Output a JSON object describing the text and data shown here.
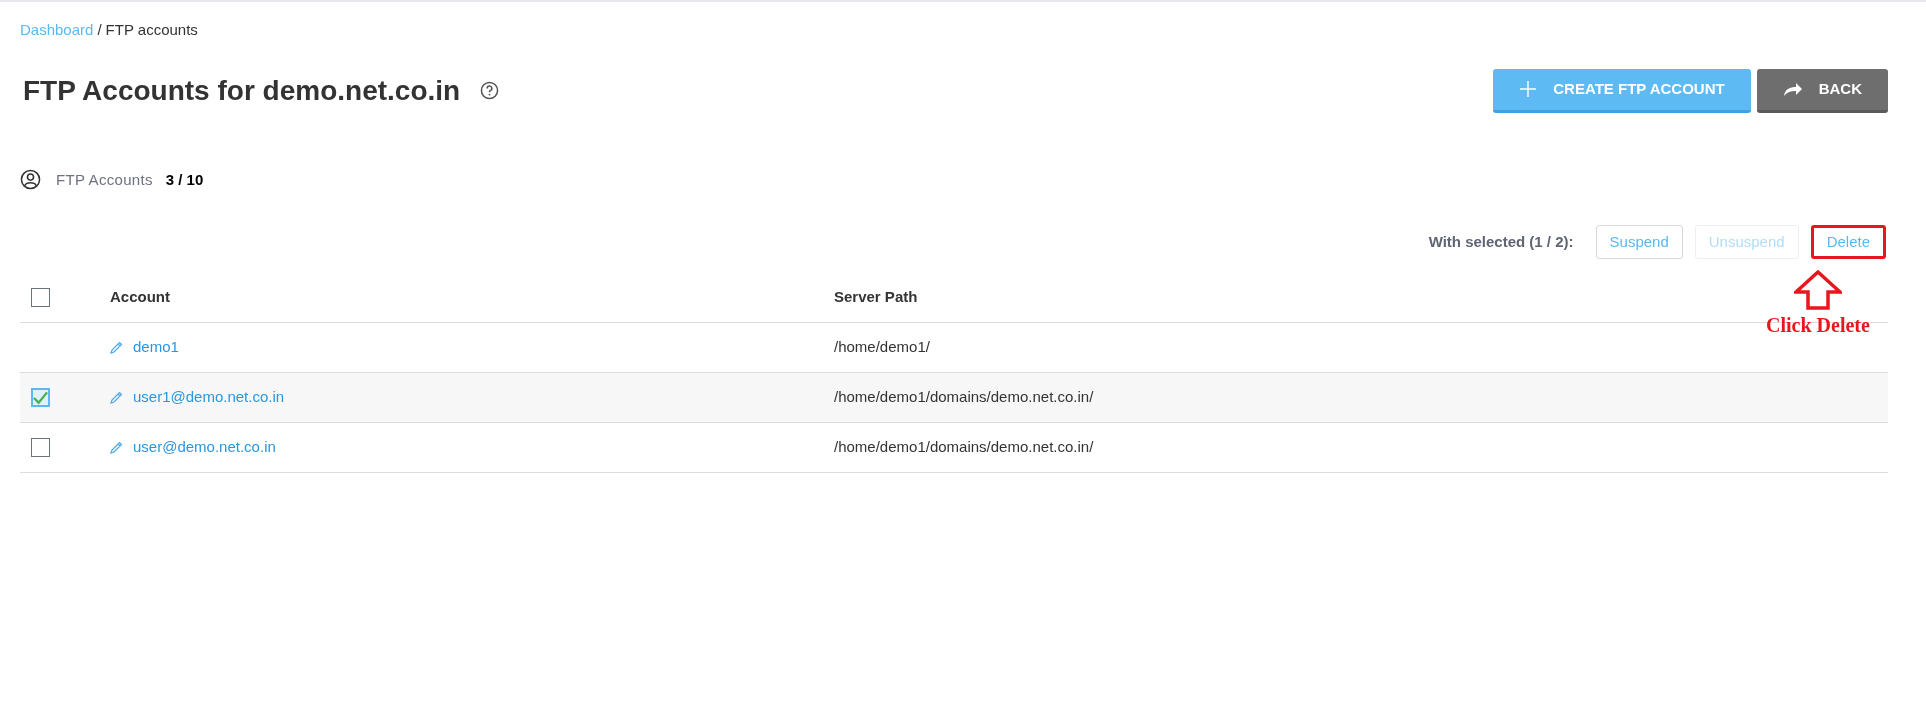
{
  "breadcrumb": [
    {
      "label": "Dashboard",
      "kind": "link"
    },
    {
      "label": "/",
      "kind": "separator"
    },
    {
      "label": "FTP accounts",
      "kind": "current"
    }
  ],
  "title": "FTP Accounts for demo.net.co.in",
  "header_buttons": [
    {
      "label": "CREATE FTP ACCOUNT",
      "kind": "primary"
    },
    {
      "label": "BACK",
      "kind": "secondary"
    }
  ],
  "stats": {
    "label": "FTP Accounts",
    "value": "3 / 10"
  },
  "bulk_actions": {
    "label": "With selected (1 / 2):",
    "buttons": [
      {
        "label": "Suspend",
        "disabled": false,
        "highlighted": false
      },
      {
        "label": "Unsuspend",
        "disabled": true,
        "highlighted": false
      },
      {
        "label": "Delete",
        "disabled": false,
        "highlighted": true
      }
    ]
  },
  "annotation": {
    "text": "Click Delete"
  },
  "table": {
    "select_all": {
      "checked": false
    },
    "columns": [
      "Account",
      "Server Path"
    ],
    "rows": [
      {
        "account": "demo1",
        "server_path": "/home/demo1/",
        "selectable": false
      },
      {
        "account": "user1@demo.net.co.in",
        "server_path": "/home/demo1/domains/demo.net.co.in/",
        "selectable": true,
        "checked": true
      },
      {
        "account": "user@demo.net.co.in",
        "server_path": "/home/demo1/domains/demo.net.co.in/",
        "selectable": true,
        "checked": false
      }
    ]
  }
}
